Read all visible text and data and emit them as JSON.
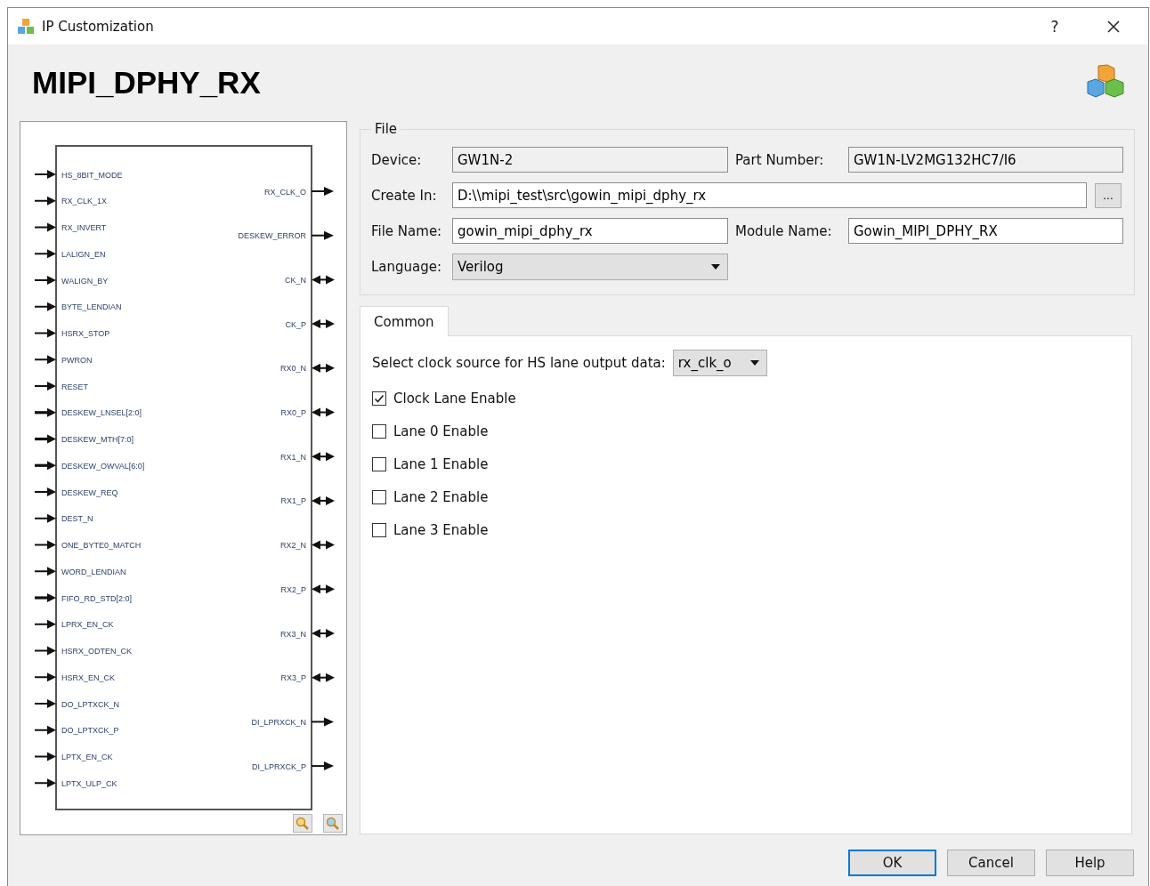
{
  "window": {
    "title": "IP Customization",
    "help_button": "?"
  },
  "heading": "MIPI_DPHY_RX",
  "diagram": {
    "left_pins": [
      {
        "name": "HS_8BIT_MODE",
        "kind": "in"
      },
      {
        "name": "RX_CLK_1X",
        "kind": "in"
      },
      {
        "name": "RX_INVERT",
        "kind": "in"
      },
      {
        "name": "LALIGN_EN",
        "kind": "in"
      },
      {
        "name": "WALIGN_BY",
        "kind": "in"
      },
      {
        "name": "BYTE_LENDIAN",
        "kind": "in"
      },
      {
        "name": "HSRX_STOP",
        "kind": "in"
      },
      {
        "name": "PWRON",
        "kind": "in"
      },
      {
        "name": "RESET",
        "kind": "in"
      },
      {
        "name": "DESKEW_LNSEL[2:0]",
        "kind": "bus"
      },
      {
        "name": "DESKEW_MTH[7:0]",
        "kind": "bus"
      },
      {
        "name": "DESKEW_OWVAL[6:0]",
        "kind": "bus"
      },
      {
        "name": "DESKEW_REQ",
        "kind": "in"
      },
      {
        "name": "DEST_N",
        "kind": "in"
      },
      {
        "name": "ONE_BYTE0_MATCH",
        "kind": "in"
      },
      {
        "name": "WORD_LENDIAN",
        "kind": "in"
      },
      {
        "name": "FIFO_RD_STD[2:0]",
        "kind": "bus"
      },
      {
        "name": "LPRX_EN_CK",
        "kind": "in"
      },
      {
        "name": "HSRX_ODTEN_CK",
        "kind": "in"
      },
      {
        "name": "HSRX_EN_CK",
        "kind": "in"
      },
      {
        "name": "DO_LPTXCK_N",
        "kind": "in"
      },
      {
        "name": "DO_LPTXCK_P",
        "kind": "in"
      },
      {
        "name": "LPTX_EN_CK",
        "kind": "in"
      },
      {
        "name": "LPTX_ULP_CK",
        "kind": "in"
      }
    ],
    "right_pins": [
      {
        "name": "RX_CLK_O",
        "kind": "out"
      },
      {
        "name": "DESKEW_ERROR",
        "kind": "out"
      },
      {
        "name": "CK_N",
        "kind": "inout"
      },
      {
        "name": "CK_P",
        "kind": "inout"
      },
      {
        "name": "RX0_N",
        "kind": "inout"
      },
      {
        "name": "RX0_P",
        "kind": "inout"
      },
      {
        "name": "RX1_N",
        "kind": "inout"
      },
      {
        "name": "RX1_P",
        "kind": "inout"
      },
      {
        "name": "RX2_N",
        "kind": "inout"
      },
      {
        "name": "RX2_P",
        "kind": "inout"
      },
      {
        "name": "RX3_N",
        "kind": "inout"
      },
      {
        "name": "RX3_P",
        "kind": "inout"
      },
      {
        "name": "DI_LPRXCK_N",
        "kind": "out"
      },
      {
        "name": "DI_LPRXCK_P",
        "kind": "out"
      }
    ]
  },
  "file": {
    "title": "File",
    "device": {
      "label": "Device:",
      "value": "GW1N-2"
    },
    "part_number": {
      "label": "Part Number:",
      "value": "GW1N-LV2MG132HC7/I6"
    },
    "create_in": {
      "label": "Create In:",
      "value": "D:\\\\mipi_test\\src\\gowin_mipi_dphy_rx",
      "browse": "..."
    },
    "file_name": {
      "label": "File Name:",
      "value": "gowin_mipi_dphy_rx"
    },
    "module_name": {
      "label": "Module Name:",
      "value": "Gowin_MIPI_DPHY_RX"
    },
    "language": {
      "label": "Language:",
      "value": "Verilog"
    }
  },
  "tabs": [
    {
      "label": "Common",
      "selected": true
    }
  ],
  "common": {
    "clock_source": {
      "label": "Select clock source for HS lane output data:",
      "value": "rx_clk_o"
    },
    "checkboxes": [
      {
        "label": "Clock Lane Enable",
        "checked": true
      },
      {
        "label": "Lane 0 Enable",
        "checked": false
      },
      {
        "label": "Lane 1 Enable",
        "checked": false
      },
      {
        "label": "Lane 2 Enable",
        "checked": false
      },
      {
        "label": "Lane 3 Enable",
        "checked": false
      }
    ]
  },
  "buttons": [
    {
      "label": "OK",
      "default": true
    },
    {
      "label": "Cancel",
      "default": false
    },
    {
      "label": "Help",
      "default": false
    }
  ]
}
